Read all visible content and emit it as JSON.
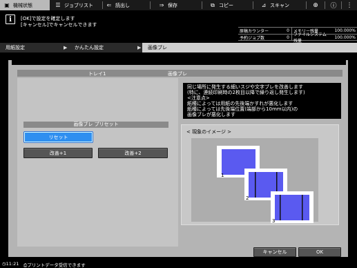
{
  "tabs": [
    {
      "label": "機械状態",
      "icon": "machine-icon",
      "active": true
    },
    {
      "label": "ジョブリスト",
      "icon": "list-icon",
      "active": false
    },
    {
      "label": "読出し",
      "icon": "retrieve-icon",
      "active": false
    },
    {
      "label": "保存",
      "icon": "save-icon",
      "active": false
    },
    {
      "label": "コピー",
      "icon": "copy-icon",
      "active": false
    },
    {
      "label": "スキャン",
      "icon": "scan-icon",
      "active": false
    }
  ],
  "message": {
    "line1": "[OK]で設定を確定します",
    "line2": "[キャンセル]でキャンセルできます"
  },
  "status": {
    "reserved_counter_label": "原稿カウンター",
    "reserved_counter_value": "0",
    "memory_label": "メモリー残量",
    "memory_value": "100.000%",
    "job_counter_label": "予約ジョブ数",
    "job_counter_value": "0",
    "filesystem_label": "ファイルシステム残量",
    "filesystem_value": "100.000%"
  },
  "breadcrumb": {
    "item1": "用紙設定",
    "item2": "かんたん設定",
    "current": "画像ブレ"
  },
  "header": {
    "tray": "トレイ1",
    "title": "画像ブレ"
  },
  "preset": {
    "label": "画像ブレ プリセット",
    "reset": "リセット",
    "improve1": "改善+1",
    "improve2": "改善+2"
  },
  "description": [
    "同じ場所に発生する細いスジや文字ブレを改善します",
    "(特に、連続印刷時の2枚目以降で繰り返し発生します)",
    "<注意点>",
    "紙種によっては用紙の先後端かすれが悪化します",
    "紙種によっては先後端位置(端部から10mm以内)の",
    "画像ブレが悪化します"
  ],
  "image_caption": "< 現象のイメージ >",
  "sheets": [
    "1",
    "2",
    "3"
  ],
  "buttons": {
    "cancel": "キャンセル",
    "ok": "OK"
  },
  "footer": {
    "clock": "11:21",
    "message": "プリントデータ受信できます"
  },
  "colors": {
    "sheet_blue": "#5a5af0",
    "accent_blue": "#2f8ff0"
  }
}
